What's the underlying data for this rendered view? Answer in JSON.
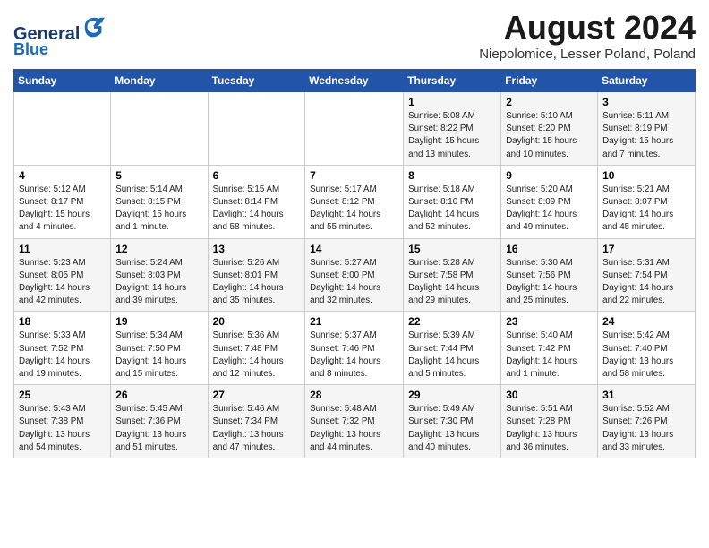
{
  "header": {
    "logo_line1": "General",
    "logo_line2": "Blue",
    "title": "August 2024",
    "subtitle": "Niepolomice, Lesser Poland, Poland"
  },
  "weekdays": [
    "Sunday",
    "Monday",
    "Tuesday",
    "Wednesday",
    "Thursday",
    "Friday",
    "Saturday"
  ],
  "weeks": [
    [
      {
        "day": "",
        "info": ""
      },
      {
        "day": "",
        "info": ""
      },
      {
        "day": "",
        "info": ""
      },
      {
        "day": "",
        "info": ""
      },
      {
        "day": "1",
        "info": "Sunrise: 5:08 AM\nSunset: 8:22 PM\nDaylight: 15 hours\nand 13 minutes."
      },
      {
        "day": "2",
        "info": "Sunrise: 5:10 AM\nSunset: 8:20 PM\nDaylight: 15 hours\nand 10 minutes."
      },
      {
        "day": "3",
        "info": "Sunrise: 5:11 AM\nSunset: 8:19 PM\nDaylight: 15 hours\nand 7 minutes."
      }
    ],
    [
      {
        "day": "4",
        "info": "Sunrise: 5:12 AM\nSunset: 8:17 PM\nDaylight: 15 hours\nand 4 minutes."
      },
      {
        "day": "5",
        "info": "Sunrise: 5:14 AM\nSunset: 8:15 PM\nDaylight: 15 hours\nand 1 minute."
      },
      {
        "day": "6",
        "info": "Sunrise: 5:15 AM\nSunset: 8:14 PM\nDaylight: 14 hours\nand 58 minutes."
      },
      {
        "day": "7",
        "info": "Sunrise: 5:17 AM\nSunset: 8:12 PM\nDaylight: 14 hours\nand 55 minutes."
      },
      {
        "day": "8",
        "info": "Sunrise: 5:18 AM\nSunset: 8:10 PM\nDaylight: 14 hours\nand 52 minutes."
      },
      {
        "day": "9",
        "info": "Sunrise: 5:20 AM\nSunset: 8:09 PM\nDaylight: 14 hours\nand 49 minutes."
      },
      {
        "day": "10",
        "info": "Sunrise: 5:21 AM\nSunset: 8:07 PM\nDaylight: 14 hours\nand 45 minutes."
      }
    ],
    [
      {
        "day": "11",
        "info": "Sunrise: 5:23 AM\nSunset: 8:05 PM\nDaylight: 14 hours\nand 42 minutes."
      },
      {
        "day": "12",
        "info": "Sunrise: 5:24 AM\nSunset: 8:03 PM\nDaylight: 14 hours\nand 39 minutes."
      },
      {
        "day": "13",
        "info": "Sunrise: 5:26 AM\nSunset: 8:01 PM\nDaylight: 14 hours\nand 35 minutes."
      },
      {
        "day": "14",
        "info": "Sunrise: 5:27 AM\nSunset: 8:00 PM\nDaylight: 14 hours\nand 32 minutes."
      },
      {
        "day": "15",
        "info": "Sunrise: 5:28 AM\nSunset: 7:58 PM\nDaylight: 14 hours\nand 29 minutes."
      },
      {
        "day": "16",
        "info": "Sunrise: 5:30 AM\nSunset: 7:56 PM\nDaylight: 14 hours\nand 25 minutes."
      },
      {
        "day": "17",
        "info": "Sunrise: 5:31 AM\nSunset: 7:54 PM\nDaylight: 14 hours\nand 22 minutes."
      }
    ],
    [
      {
        "day": "18",
        "info": "Sunrise: 5:33 AM\nSunset: 7:52 PM\nDaylight: 14 hours\nand 19 minutes."
      },
      {
        "day": "19",
        "info": "Sunrise: 5:34 AM\nSunset: 7:50 PM\nDaylight: 14 hours\nand 15 minutes."
      },
      {
        "day": "20",
        "info": "Sunrise: 5:36 AM\nSunset: 7:48 PM\nDaylight: 14 hours\nand 12 minutes."
      },
      {
        "day": "21",
        "info": "Sunrise: 5:37 AM\nSunset: 7:46 PM\nDaylight: 14 hours\nand 8 minutes."
      },
      {
        "day": "22",
        "info": "Sunrise: 5:39 AM\nSunset: 7:44 PM\nDaylight: 14 hours\nand 5 minutes."
      },
      {
        "day": "23",
        "info": "Sunrise: 5:40 AM\nSunset: 7:42 PM\nDaylight: 14 hours\nand 1 minute."
      },
      {
        "day": "24",
        "info": "Sunrise: 5:42 AM\nSunset: 7:40 PM\nDaylight: 13 hours\nand 58 minutes."
      }
    ],
    [
      {
        "day": "25",
        "info": "Sunrise: 5:43 AM\nSunset: 7:38 PM\nDaylight: 13 hours\nand 54 minutes."
      },
      {
        "day": "26",
        "info": "Sunrise: 5:45 AM\nSunset: 7:36 PM\nDaylight: 13 hours\nand 51 minutes."
      },
      {
        "day": "27",
        "info": "Sunrise: 5:46 AM\nSunset: 7:34 PM\nDaylight: 13 hours\nand 47 minutes."
      },
      {
        "day": "28",
        "info": "Sunrise: 5:48 AM\nSunset: 7:32 PM\nDaylight: 13 hours\nand 44 minutes."
      },
      {
        "day": "29",
        "info": "Sunrise: 5:49 AM\nSunset: 7:30 PM\nDaylight: 13 hours\nand 40 minutes."
      },
      {
        "day": "30",
        "info": "Sunrise: 5:51 AM\nSunset: 7:28 PM\nDaylight: 13 hours\nand 36 minutes."
      },
      {
        "day": "31",
        "info": "Sunrise: 5:52 AM\nSunset: 7:26 PM\nDaylight: 13 hours\nand 33 minutes."
      }
    ]
  ]
}
